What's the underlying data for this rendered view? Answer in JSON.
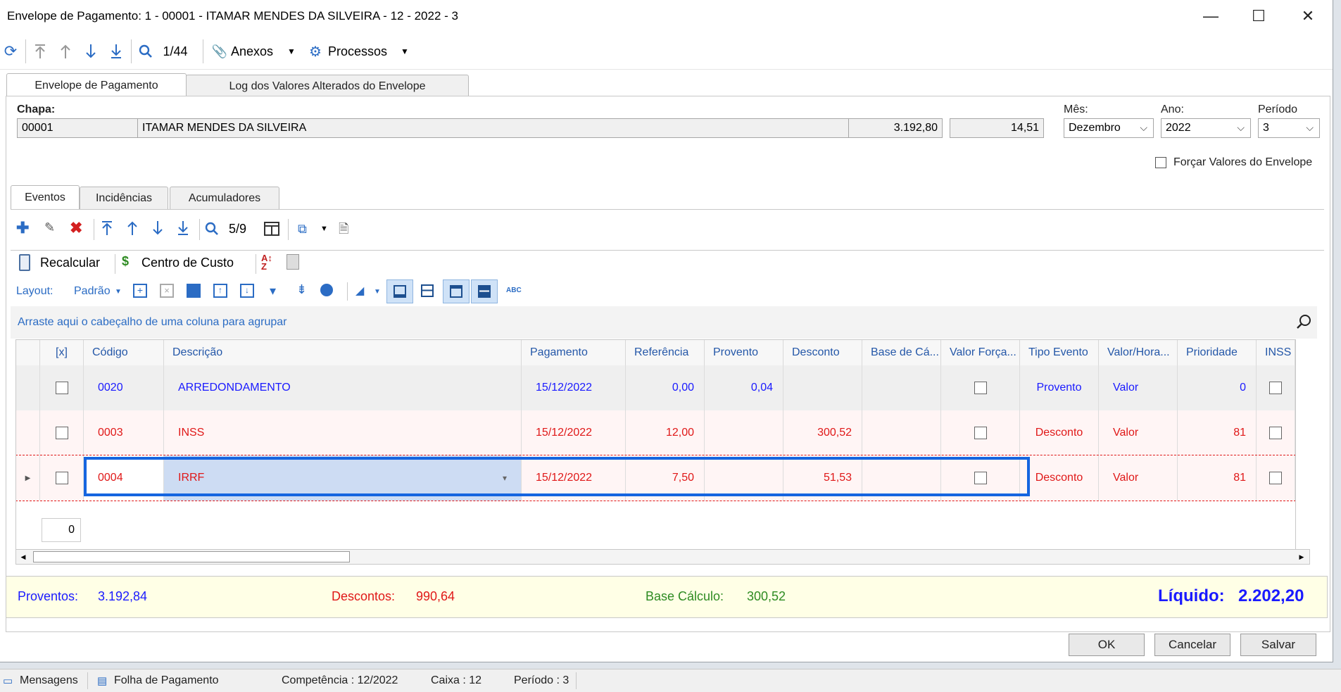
{
  "window": {
    "title": "Envelope de Pagamento: 1 - 00001 - ITAMAR MENDES DA SILVEIRA - 12 - 2022 - 3",
    "controls": {
      "minimize": "—",
      "maximize": "☐",
      "close": "✕"
    }
  },
  "toolbar": {
    "record_position": "1/44",
    "attachments_label": "Anexos",
    "processes_label": "Processos"
  },
  "main_tabs": [
    "Envelope de Pagamento",
    "Log dos Valores Alterados do Envelope"
  ],
  "header": {
    "chapa_label": "Chapa:",
    "chapa_value": "00001",
    "name_value": "ITAMAR MENDES DA SILVEIRA",
    "value1": "3.192,80",
    "value2": "14,51",
    "mes_label": "Mês:",
    "mes_value": "Dezembro",
    "ano_label": "Ano:",
    "ano_value": "2022",
    "periodo_label": "Período",
    "periodo_value": "3",
    "force_label": "Forçar Valores do Envelope"
  },
  "sub_tabs": [
    "Eventos",
    "Incidências",
    "Acumuladores"
  ],
  "grid_toolbar": {
    "record_position": "5/9",
    "recalc_label": "Recalcular",
    "cost_center_label": "Centro de Custo",
    "layout_label": "Layout:",
    "layout_value": "Padrão",
    "abc_label": "ABC"
  },
  "group_hint": "Arraste aqui o cabeçalho de uma coluna para agrupar",
  "columns": [
    "[x]",
    "Código",
    "Descrição",
    "Pagamento",
    "Referência",
    "Provento",
    "Desconto",
    "Base de Cá...",
    "Valor Força...",
    "Tipo Evento",
    "Valor/Hora...",
    "Prioridade",
    "INSS"
  ],
  "rows": [
    {
      "codigo": "0020",
      "descricao": "ARREDONDAMENTO",
      "pagamento": "15/12/2022",
      "referencia": "0,00",
      "provento": "0,04",
      "desconto": "",
      "base": "",
      "tipo": "Provento",
      "valor_hora": "Valor",
      "prioridade": "0",
      "color": "#1a1aff"
    },
    {
      "codigo": "0003",
      "descricao": "INSS",
      "pagamento": "15/12/2022",
      "referencia": "12,00",
      "provento": "",
      "desconto": "300,52",
      "base": "",
      "tipo": "Desconto",
      "valor_hora": "Valor",
      "prioridade": "81",
      "color": "#e01818"
    },
    {
      "codigo": "0004",
      "descricao": "IRRF",
      "pagamento": "15/12/2022",
      "referencia": "7,50",
      "provento": "",
      "desconto": "51,53",
      "base": "",
      "tipo": "Desconto",
      "valor_hora": "Valor",
      "prioridade": "81",
      "color": "#e01818"
    }
  ],
  "footer_count": "0",
  "totals": {
    "proventos_label": "Proventos:",
    "proventos_value": "3.192,84",
    "descontos_label": "Descontos:",
    "descontos_value": "990,64",
    "base_label": "Base Cálculo:",
    "base_value": "300,52",
    "liquido_label": "Líquido:",
    "liquido_value": "2.202,20"
  },
  "buttons": {
    "ok": "OK",
    "cancel": "Cancelar",
    "save": "Salvar"
  },
  "statusbar": {
    "messages": "Mensagens",
    "payroll": "Folha de Pagamento",
    "competencia": "Competência : 12/2022",
    "caixa": "Caixa : 12",
    "periodo": "Período : 3"
  },
  "colors": {
    "accent": "#2b6cc4",
    "proventos": "#1a1aff",
    "descontos": "#e01818",
    "base": "#2e8b22",
    "selection": "#1565e0"
  }
}
